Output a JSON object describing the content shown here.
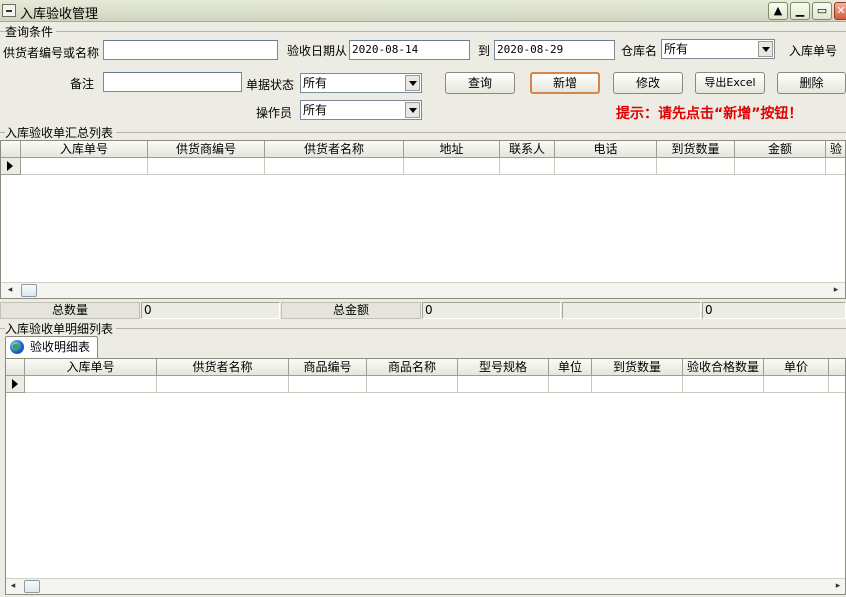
{
  "window": {
    "title": "入库验收管理",
    "minimize_glyph": "▁",
    "restore_glyph": "▭",
    "close_glyph": "✕",
    "scroll_glyph": "▲"
  },
  "query": {
    "group_label": "查询条件",
    "supplier_label": "供货者编号或名称",
    "supplier_value": "",
    "date_from_label": "验收日期从",
    "date_from": "2020-08-14",
    "date_to_label": "到",
    "date_to": "2020-08-29",
    "warehouse_label": "仓库名",
    "warehouse_value": "所有",
    "inbound_no_label": "入库单号",
    "note_label": "备注",
    "note_value": "",
    "status_label": "单据状态",
    "status_value": "所有",
    "operator_label": "操作员",
    "operator_value": "所有"
  },
  "buttons": {
    "query": "查询",
    "add": "新增",
    "edit": "修改",
    "export": "导出Excel",
    "delete": "删除"
  },
  "hint": "提示：请先点击“新增”按钮！",
  "summary_table": {
    "group_label": "入库验收单汇总列表",
    "columns": [
      "入库单号",
      "供货商编号",
      "供货者名称",
      "地址",
      "联系人",
      "电话",
      "到货数量",
      "金额",
      "验"
    ]
  },
  "totals": {
    "qty_label": "总数量",
    "qty_value": "0",
    "amount_label": "总金额",
    "amount_value": "0",
    "extra_value": "0"
  },
  "detail": {
    "group_label": "入库验收单明细列表",
    "tab_label": "验收明细表",
    "columns": [
      "入库单号",
      "供货者名称",
      "商品编号",
      "商品名称",
      "型号规格",
      "单位",
      "到货数量",
      "验收合格数量",
      "单价"
    ]
  },
  "scroll": {
    "left_arrow": "◂",
    "right_arrow": "▸"
  },
  "icons": {
    "window": "window-menu-icon",
    "tab": "globe-icon",
    "row_pointer": "row-pointer-icon"
  }
}
